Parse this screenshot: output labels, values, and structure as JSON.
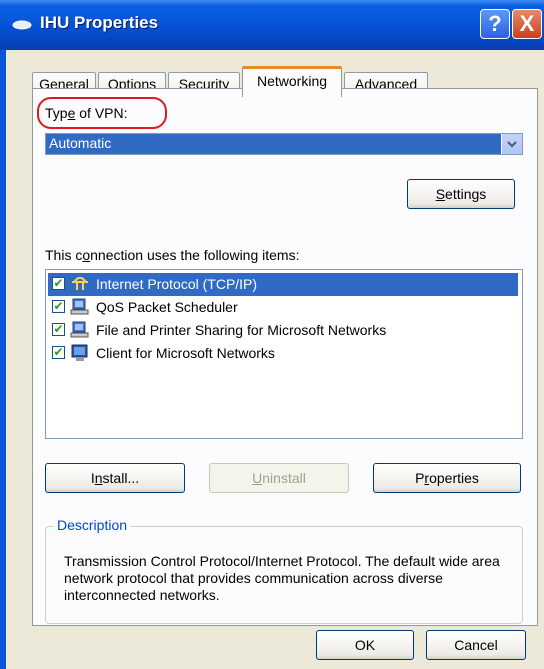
{
  "window": {
    "title": "IHU Properties",
    "help_label": "?",
    "close_label": "X"
  },
  "tabs": [
    "General",
    "Options",
    "Security",
    "Networking",
    "Advanced"
  ],
  "vpn": {
    "label_pre": "Typ",
    "label_u": "e",
    "label_post": " of VPN:",
    "selected": "Automatic"
  },
  "settings_button": {
    "u": "S",
    "rest": "ettings"
  },
  "items": {
    "label_pre": "This c",
    "label_u": "o",
    "label_post": "nnection uses the following items:",
    "rows": [
      {
        "label": "Internet Protocol (TCP/IP)",
        "icon": "protocol-icon",
        "checked": true
      },
      {
        "label": "QoS Packet Scheduler",
        "icon": "network-service-icon",
        "checked": true
      },
      {
        "label": "File and Printer Sharing for Microsoft Networks",
        "icon": "network-service-icon",
        "checked": true
      },
      {
        "label": "Client for Microsoft Networks",
        "icon": "network-client-icon",
        "checked": true
      }
    ]
  },
  "buttons": {
    "install": {
      "pre": "I",
      "u": "n",
      "post": "stall..."
    },
    "uninstall": {
      "u": "U",
      "post": "ninstall"
    },
    "properties": {
      "pre": "P",
      "u": "r",
      "post": "operties"
    },
    "ok": "OK",
    "cancel": "Cancel"
  },
  "description": {
    "title": "Description",
    "text": "Transmission Control Protocol/Internet Protocol. The default wide area network protocol that provides communication across diverse interconnected networks."
  },
  "colors": {
    "accent": "#316ac5",
    "highlight_oval": "#e01a1a",
    "tab_active_top": "#e68b2c"
  }
}
